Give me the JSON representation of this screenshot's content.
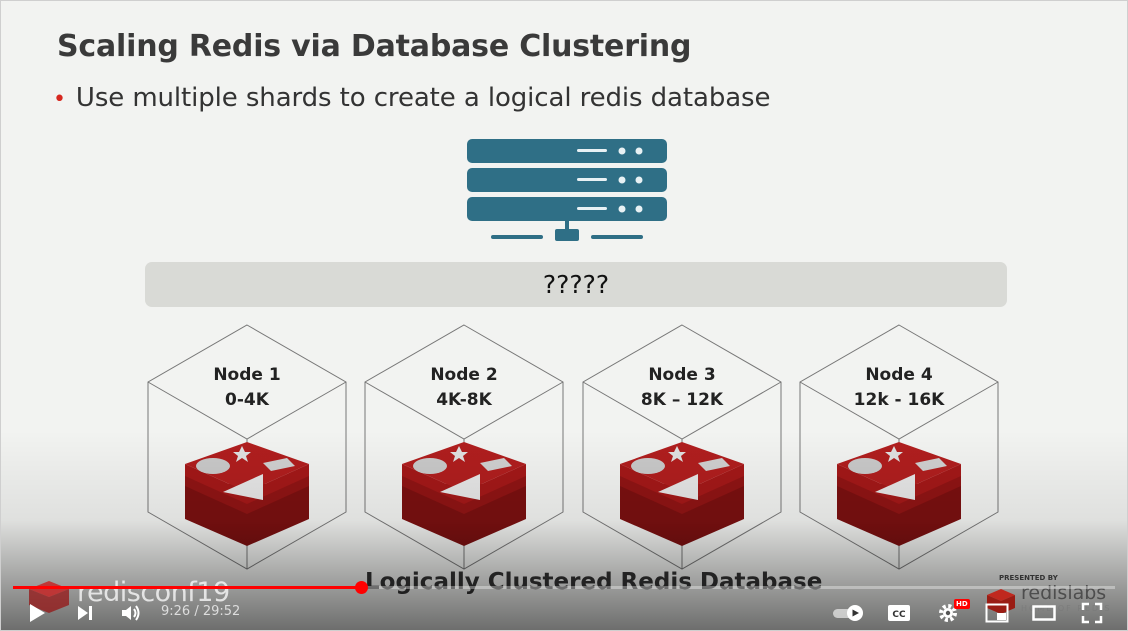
{
  "slide": {
    "title": "Scaling Redis via Database Clustering",
    "bullet": "Use multiple shards to create a logical redis database",
    "question_bar": "?????",
    "nodes": [
      {
        "name": "Node 1",
        "range": "0-4K"
      },
      {
        "name": "Node 2",
        "range": "4K-8K"
      },
      {
        "name": "Node 3",
        "range": "8K – 12K"
      },
      {
        "name": "Node 4",
        "range": "12k - 16K"
      }
    ],
    "caption": "Logically Clustered Redis Database",
    "brand_left": "redisconf19",
    "brand_right": {
      "presented": "PRESENTED BY",
      "logo": "redislabs",
      "tagline": "HOME OF REDIS"
    }
  },
  "player": {
    "current_time": "9:26",
    "duration": "29:52",
    "time_display": "9:26 / 29:52",
    "progress_fraction": 0.316,
    "hd_badge": "HD",
    "icons": [
      "play-icon",
      "next-icon",
      "volume-icon",
      "autoplay-toggle-icon",
      "captions-icon",
      "settings-icon",
      "miniplayer-icon",
      "theater-icon",
      "fullscreen-icon"
    ],
    "accent_color": "#ff0000"
  },
  "colors": {
    "server": "#2f6f86",
    "redis_red": "#b01e1e",
    "bullet_dot": "#d6271f"
  }
}
